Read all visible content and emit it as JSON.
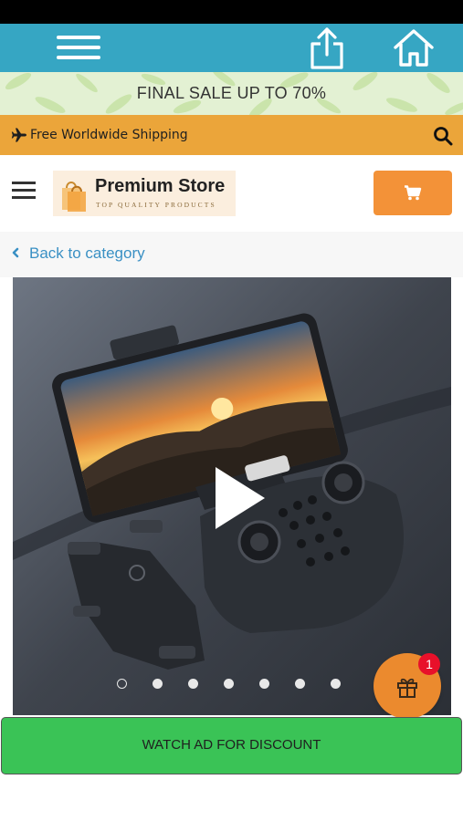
{
  "top_bar": {
    "menu_icon": "menu-icon",
    "share_icon": "share-icon",
    "home_icon": "home-icon",
    "color": "#36a6c3"
  },
  "sale_banner": {
    "text": "FINAL SALE UP TO 70%"
  },
  "shipping_bar": {
    "icon": "airplane-icon",
    "text": "Free Worldwide Shipping",
    "search_icon": "search-icon",
    "color": "#eba53a"
  },
  "store_header": {
    "menu_icon": "hamburger-icon",
    "logo_name": "Premium Store",
    "logo_tagline": "TOP QUALITY PRODUCTS",
    "cart_icon": "cart-icon",
    "cart_color": "#f39238"
  },
  "navigation": {
    "back_label": "Back to category",
    "back_icon": "chevron-left-icon"
  },
  "gallery": {
    "image_subject": "drone with remote controller and phone",
    "play_icon": "play-icon",
    "slide_count": 7,
    "active_slide": 1
  },
  "gift": {
    "icon": "gift-icon",
    "badge_count": "1"
  },
  "cta": {
    "watch_ad_label": "WATCH AD FOR DISCOUNT",
    "color": "#3ac356"
  }
}
